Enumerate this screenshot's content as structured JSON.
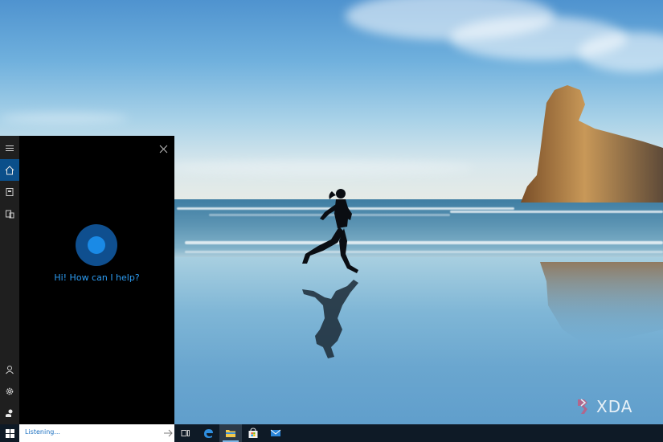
{
  "watermark": {
    "text": "XDA"
  },
  "cortana": {
    "greeting": "Hi! How can I help?",
    "rail": [
      {
        "icon": "hamburger-menu-icon"
      },
      {
        "icon": "home-icon",
        "active": true
      },
      {
        "icon": "notebook-icon"
      },
      {
        "icon": "devices-icon"
      },
      {
        "icon": "account-icon"
      },
      {
        "icon": "settings-gear-icon"
      },
      {
        "icon": "feedback-icon"
      }
    ],
    "accent_color": "#2d9cf2"
  },
  "taskbar": {
    "search": {
      "value": "Listening..."
    },
    "icons": [
      "task-view-icon",
      "edge-icon",
      "file-explorer-icon",
      "store-icon",
      "mail-icon"
    ],
    "active_icon": "file-explorer-icon"
  }
}
